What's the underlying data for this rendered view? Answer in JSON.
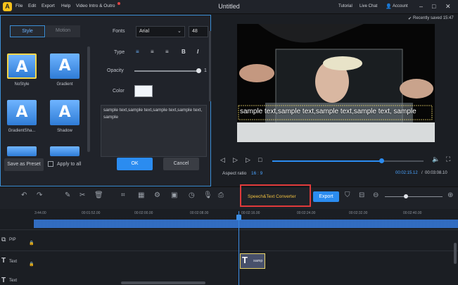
{
  "titlebar": {
    "logo": "A",
    "menu": [
      "File",
      "Edit",
      "Export",
      "Help",
      "Video Intro & Outro"
    ],
    "title": "Untitled",
    "links": [
      "Tutorial",
      "Live Chat",
      "Account"
    ],
    "window": [
      "–",
      "□",
      "✕"
    ],
    "saved": "Recently saved 15:47"
  },
  "left": {
    "tabs": [
      "Style",
      "Motion"
    ],
    "presets": [
      "NoStyle",
      "Gradient",
      "GradientSha...",
      "Shadow"
    ],
    "preset_glyph": "A",
    "fonts_label": "Fonts",
    "font_value": "Arial",
    "font_size": "48",
    "type_label": "Type",
    "type_icons": [
      "≡",
      "≡",
      "≡",
      "B",
      "I"
    ],
    "opacity_label": "Opacity",
    "opacity_value": "1",
    "opacity_level": 1.0,
    "color_label": "Color",
    "color_value": "#f2f6fb",
    "text": "sample text,sample text,sample text,sample text, sample",
    "save_preset": "Save as Preset",
    "apply_all": "Apply to all",
    "ok": "OK",
    "cancel": "Cancel"
  },
  "preview": {
    "caption": "sample text,sample text,sample text,sample text, sample",
    "aspect_label": "Aspect ratio",
    "aspect_value": "16 : 9",
    "time_current": "00:02:15.12",
    "time_total": "00:03:08.10",
    "progress": 0.72
  },
  "toolbar": {
    "speech": "Speech&Text Converter",
    "export": "Export"
  },
  "ruler": [
    "3:44.00",
    "00:01:52.00",
    "00:02:00.00",
    "00:02:08.00",
    "00:02:16.00",
    "00:02:24.00",
    "00:02:32.00",
    "00:02:40.00"
  ],
  "tracks": {
    "pip": "PIP",
    "text": "Text",
    "text2": "Text",
    "clip": "samp"
  }
}
